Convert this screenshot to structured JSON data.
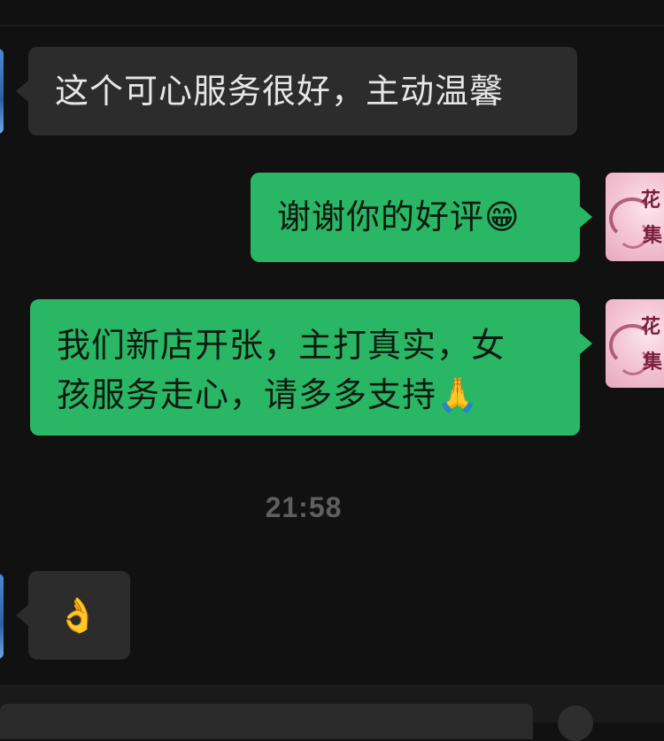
{
  "messages": [
    {
      "sender": "other",
      "text": "这个可心服务很好，主动温馨"
    },
    {
      "sender": "me",
      "text": "谢谢你的好评",
      "emoji": "😁"
    },
    {
      "sender": "me",
      "line1": "我们新店开张，主打真实，女",
      "line2": "孩服务走心，请多多支持",
      "emoji": "🙏"
    },
    {
      "sender": "other",
      "text": "👌"
    }
  ],
  "timestamp": "21:58",
  "avatar_me": {
    "logo_chars": [
      "花",
      "集"
    ],
    "colors": {
      "bg": "#f4c6d6",
      "ink": "#7a1e3c"
    }
  },
  "colors": {
    "background": "#111111",
    "bubble_in": "#2c2c2c",
    "bubble_out": "#2ab765",
    "timestamp": "#5f5f5f"
  }
}
